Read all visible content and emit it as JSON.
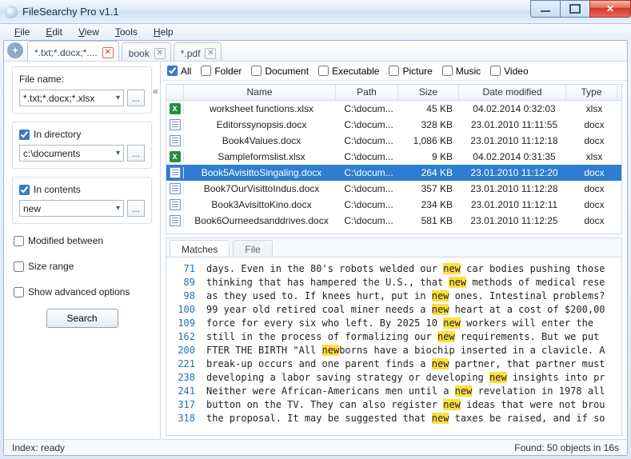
{
  "title": "FileSearchy Pro v1.1",
  "menu": {
    "file": "File",
    "edit": "Edit",
    "view": "View",
    "tools": "Tools",
    "help": "Help"
  },
  "tabs": [
    {
      "label": "*.txt;*.docx;*....",
      "active": true
    },
    {
      "label": "book",
      "active": false
    },
    {
      "label": "*.pdf",
      "active": false
    }
  ],
  "left": {
    "filename_lbl": "File name:",
    "filename_val": "*.txt;*.docx;*.xlsx",
    "indir_lbl": "In directory",
    "indir_val": "c:\\documents",
    "incontents_lbl": "In contents",
    "incontents_val": "new",
    "modified_lbl": "Modified between",
    "sizerange_lbl": "Size range",
    "advanced_lbl": "Show advanced options",
    "search_btn": "Search"
  },
  "filters": {
    "all": "All",
    "folder": "Folder",
    "document": "Document",
    "executable": "Executable",
    "picture": "Picture",
    "music": "Music",
    "video": "Video"
  },
  "columns": {
    "name": "Name",
    "path": "Path",
    "size": "Size",
    "date": "Date modified",
    "type": "Type"
  },
  "rows": [
    {
      "icon": "xls",
      "name": "worksheet functions.xlsx",
      "path": "C:\\docum...",
      "size": "45 KB",
      "date": "04.02.2014 0:32:03",
      "type": "xlsx"
    },
    {
      "icon": "doc",
      "name": "Editorssynopsis.docx",
      "path": "C:\\docum...",
      "size": "328 KB",
      "date": "23.01.2010 11:11:55",
      "type": "docx"
    },
    {
      "icon": "doc",
      "name": "Book4Values.docx",
      "path": "C:\\docum...",
      "size": "1,086 KB",
      "date": "23.01.2010 11:12:18",
      "type": "docx"
    },
    {
      "icon": "xls",
      "name": "Sampleformslist.xlsx",
      "path": "C:\\docum...",
      "size": "9 KB",
      "date": "04.02.2014 0:31:35",
      "type": "xlsx"
    },
    {
      "icon": "doc",
      "name": "Book5AvisittoSingaling.docx",
      "path": "C:\\docum...",
      "size": "264 KB",
      "date": "23.01.2010 11:12:20",
      "type": "docx",
      "selected": true
    },
    {
      "icon": "doc",
      "name": "Book7OurVisittoIndus.docx",
      "path": "C:\\docum...",
      "size": "357 KB",
      "date": "23.01.2010 11:12:28",
      "type": "docx"
    },
    {
      "icon": "doc",
      "name": "Book3AvisittoKino.docx",
      "path": "C:\\docum...",
      "size": "234 KB",
      "date": "23.01.2010 11:12:11",
      "type": "docx"
    },
    {
      "icon": "doc",
      "name": "Book6Ourneedsanddrives.docx",
      "path": "C:\\docum...",
      "size": "581 KB",
      "date": "23.01.2010 11:12:25",
      "type": "docx"
    }
  ],
  "preview_tabs": {
    "matches": "Matches",
    "file": "File"
  },
  "preview": [
    {
      "n": "71",
      "t": "days. Even in the 80's robots welded our ",
      "h": "new",
      "r": " car bodies pushing those"
    },
    {
      "n": "89",
      "t": "thinking that has hampered the U.S., that ",
      "h": "new",
      "r": " methods of medical rese"
    },
    {
      "n": "98",
      "t": "as they used to. If knees hurt, put in ",
      "h": "new",
      "r": " ones. Intestinal problems?"
    },
    {
      "n": "100",
      "t": "99 year old retired coal miner needs a ",
      "h": "new",
      "r": " heart at a cost of $200,00"
    },
    {
      "n": "109",
      "t": "force for every six who left. By 2025   10 ",
      "h": "new",
      "r": " workers will enter the"
    },
    {
      "n": "162",
      "t": "still in the process of formalizing our ",
      "h": "new",
      "r": " requirements. But we put"
    },
    {
      "n": "200",
      "t": "FTER THE BIRTH \"All ",
      "h": "new",
      "r": "borns have a biochip inserted in a clavicle. A"
    },
    {
      "n": "221",
      "t": "break-up occurs and one parent finds a ",
      "h": "new",
      "r": " partner, that partner must"
    },
    {
      "n": "238",
      "t": "developing a labor saving strategy or developing ",
      "h": "new",
      "r": " insights into pr"
    },
    {
      "n": "241",
      "t": "Neither were African-Americans men until a ",
      "h": "new",
      "r": " revelation in 1978 all"
    },
    {
      "n": "317",
      "t": "button on the TV. They can also register ",
      "h": "new",
      "r": " ideas that were not brou"
    },
    {
      "n": "318",
      "t": "the proposal. It may be suggested that ",
      "h": "new",
      "r": " taxes be raised, and if so"
    }
  ],
  "status": {
    "left": "Index: ready",
    "right": "Found: 50 objects in 16s"
  }
}
